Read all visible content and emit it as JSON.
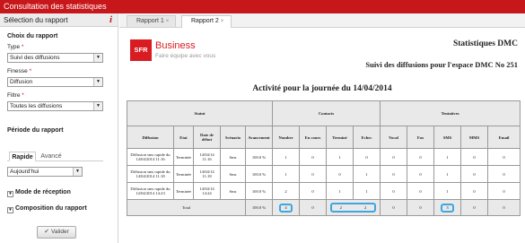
{
  "app_title": "Consultation des statistiques",
  "left_panel": {
    "header": "Sélection du rapport",
    "choice_title": "Choix du rapport",
    "type_label": "Type",
    "type_value": "Suivi des diffusions",
    "finesse_label": "Finesse",
    "finesse_value": "Diffusion",
    "filtre_label": "Filtre",
    "filtre_value": "Toutes les diffusions",
    "period_title": "Période du rapport",
    "period_tabs": [
      "Rapide",
      "Avancé"
    ],
    "period_value": "Aujourd'hui",
    "reception_mode": "Mode de réception",
    "composition": "Composition du rapport",
    "validate": "Valider",
    "required_mark": "*"
  },
  "tabs": [
    {
      "label": "Rapport 1",
      "close": "×"
    },
    {
      "label": "Rapport 2",
      "close": "×"
    }
  ],
  "report": {
    "brand_badge": "SFR",
    "brand_name": "Business",
    "brand_tagline": "Faire équipe avec vous",
    "title": "Statistiques DMC",
    "subtitle": "Suivi des diffusions pour l'espace DMC No 251",
    "activity_title": "Activité pour la  journée  du 14/04/2014",
    "group_headers": {
      "status": "Statut",
      "contacts": "Contacts",
      "attempts": "Tentatives"
    },
    "columns": [
      "Diffusion",
      "Etat",
      "Date de début",
      "Scénario",
      "Avancement",
      "Nombre",
      "En cours",
      "Terminé",
      "Echec",
      "Vocal",
      "Fax",
      "SMS",
      "MMS",
      "Email"
    ],
    "rows": [
      [
        "Diffusion sms rapide du 14/04/2014 11:16",
        "Terminée",
        "14/04/14 11:16",
        "Sms",
        "100.0 %",
        "1",
        "0",
        "1",
        "0",
        "0",
        "0",
        "1",
        "0",
        "0"
      ],
      [
        "Diffusion sms rapide du 14/04/2014 11:18",
        "Terminée",
        "14/04/14 11:18",
        "Sms",
        "100.0 %",
        "1",
        "0",
        "0",
        "1",
        "0",
        "0",
        "1",
        "0",
        "0"
      ],
      [
        "Diffusion sms rapide du 14/04/2014 14:23",
        "Terminée",
        "14/04/14 14:24",
        "Sms",
        "100.0 %",
        "2",
        "0",
        "1",
        "1",
        "0",
        "0",
        "1",
        "0",
        "0"
      ]
    ],
    "total": {
      "label": "Total",
      "avancement": "100.0 %",
      "values": [
        "4",
        "0",
        "2",
        "2",
        "0",
        "0",
        "3",
        "0",
        "0"
      ]
    }
  },
  "colors": {
    "brand_red": "#c7171b",
    "highlight": "#3ea6e0"
  }
}
